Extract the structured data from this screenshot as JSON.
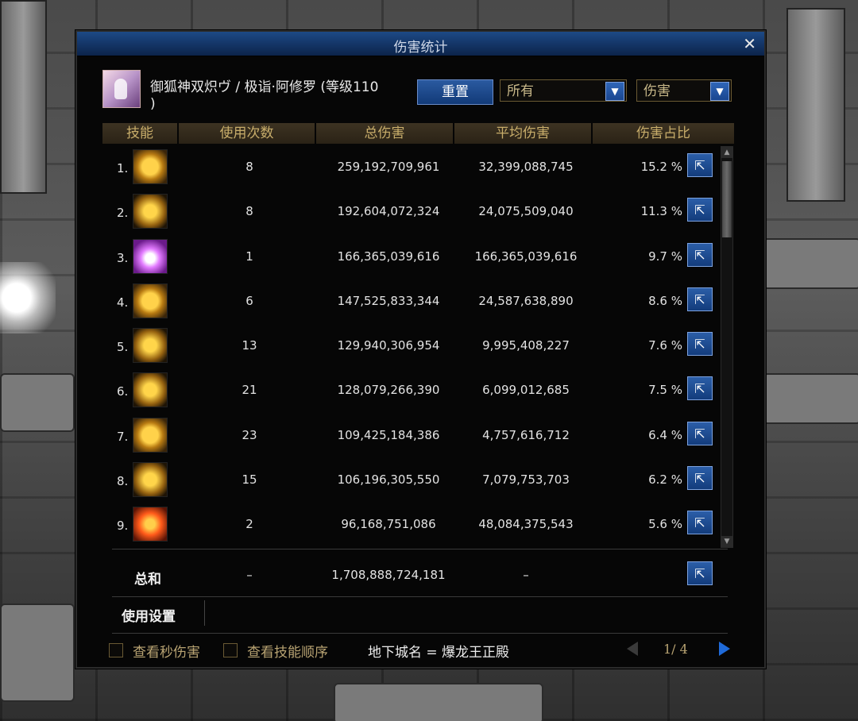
{
  "window": {
    "title": "伤害统计",
    "close_label": "✕"
  },
  "character": {
    "name_line1": "御狐神双炽ヴ / 极诣·阿修罗 (等级110",
    "name_line2": ")"
  },
  "controls": {
    "reset_label": "重置",
    "scope_value": "所有",
    "type_value": "伤害",
    "dropdown_icon": "chevron-down-icon"
  },
  "table": {
    "headers": [
      "技能",
      "使用次数",
      "总伤害",
      "平均伤害",
      "伤害占比"
    ],
    "rows": [
      {
        "index": "1.",
        "icon": "lightning-fist-icon",
        "uses": "8",
        "total": "259,192,709,961",
        "avg": "32,399,088,745",
        "pct": "15.2 %"
      },
      {
        "index": "2.",
        "icon": "slash-wave-icon",
        "uses": "8",
        "total": "192,604,072,324",
        "avg": "24,075,509,040",
        "pct": "11.3 %"
      },
      {
        "index": "3.",
        "icon": "purple-burst-icon",
        "uses": "1",
        "total": "166,365,039,616",
        "avg": "166,365,039,616",
        "pct": "9.7 %"
      },
      {
        "index": "4.",
        "icon": "golden-ring-icon",
        "uses": "6",
        "total": "147,525,833,344",
        "avg": "24,587,638,890",
        "pct": "8.6 %"
      },
      {
        "index": "5.",
        "icon": "crown-spikes-icon",
        "uses": "13",
        "total": "129,940,306,954",
        "avg": "9,995,408,227",
        "pct": "7.6 %"
      },
      {
        "index": "6.",
        "icon": "crescent-wave-icon",
        "uses": "21",
        "total": "128,079,266,390",
        "avg": "6,099,012,685",
        "pct": "7.5 %"
      },
      {
        "index": "7.",
        "icon": "sun-face-icon",
        "uses": "23",
        "total": "109,425,184,386",
        "avg": "4,757,616,712",
        "pct": "6.4 %"
      },
      {
        "index": "8.",
        "icon": "warrior-stance-icon",
        "uses": "15",
        "total": "106,196,305,550",
        "avg": "7,079,753,703",
        "pct": "6.2 %"
      },
      {
        "index": "9.",
        "icon": "fire-strike-icon",
        "uses": "2",
        "total": "96,168,751,086",
        "avg": "48,084,375,543",
        "pct": "5.6 %"
      }
    ],
    "share_icon": "share-export-icon"
  },
  "summary": {
    "label": "总和",
    "uses": "–",
    "total": "1,708,888,724,181",
    "avg": "–"
  },
  "settings": {
    "label": "使用设置"
  },
  "footer": {
    "checkbox1_label": "查看秒伤害",
    "checkbox2_label": "查看技能顺序",
    "dungeon": "地下城名 = 爆龙王正殿",
    "page": "1/ 4"
  },
  "colors": {
    "title_bar": "#143668",
    "header_gold": "#c8ad6a",
    "button_blue": "#1a4690",
    "panel_bg": "#060606"
  }
}
